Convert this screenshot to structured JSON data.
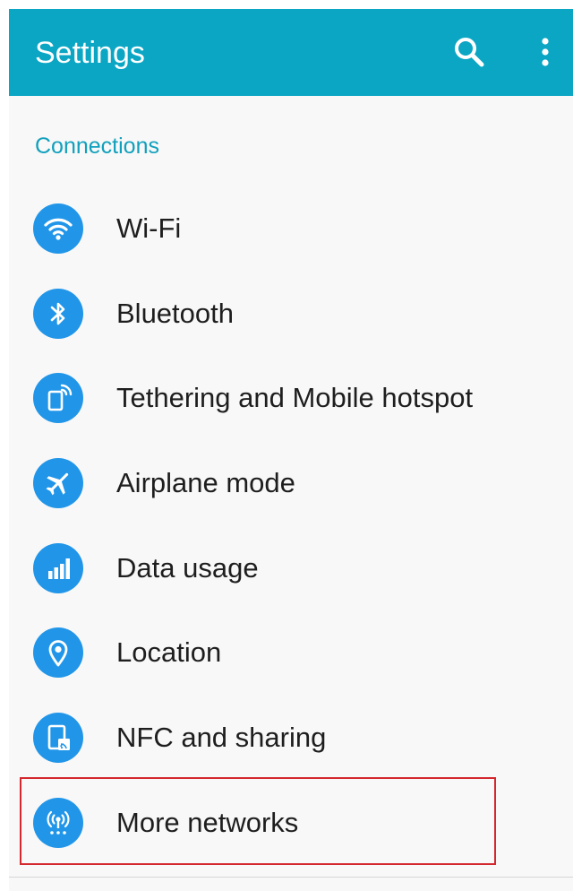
{
  "appbar": {
    "title": "Settings",
    "background": "#0aa6c4",
    "actions": [
      "search-icon",
      "more-vert-icon"
    ]
  },
  "section": {
    "title": "Connections",
    "color": "#11a0bd"
  },
  "items": [
    {
      "label": "Wi-Fi",
      "icon": "wifi-icon"
    },
    {
      "label": "Bluetooth",
      "icon": "bluetooth-icon"
    },
    {
      "label": "Tethering and Mobile hotspot",
      "icon": "hotspot-icon"
    },
    {
      "label": "Airplane mode",
      "icon": "airplane-icon"
    },
    {
      "label": "Data usage",
      "icon": "data-usage-icon"
    },
    {
      "label": "Location",
      "icon": "location-icon"
    },
    {
      "label": "NFC and sharing",
      "icon": "nfc-icon"
    },
    {
      "label": "More networks",
      "icon": "antenna-icon",
      "highlighted": true
    }
  ],
  "colors": {
    "icon_circle": "#2196e9",
    "highlight_border": "#d3282e",
    "background": "#f8f8f8"
  }
}
